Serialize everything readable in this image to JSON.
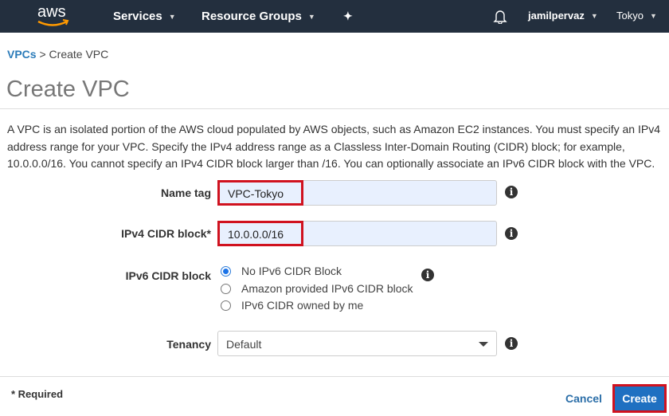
{
  "nav": {
    "logo": "aws",
    "services": "Services",
    "resource_groups": "Resource Groups",
    "user": "jamilpervaz",
    "region": "Tokyo"
  },
  "breadcrumb": {
    "parent": "VPCs",
    "separator": ">",
    "current": "Create VPC"
  },
  "page": {
    "title": "Create VPC",
    "description": "A VPC is an isolated portion of the AWS cloud populated by AWS objects, such as Amazon EC2 instances. You must specify an IPv4 address range for your VPC. Specify the IPv4 address range as a Classless Inter-Domain Routing (CIDR) block; for example, 10.0.0.0/16. You cannot specify an IPv4 CIDR block larger than /16. You can optionally associate an IPv6 CIDR block with the VPC."
  },
  "form": {
    "name_tag": {
      "label": "Name tag",
      "value": "VPC-Tokyo"
    },
    "ipv4": {
      "label": "IPv4 CIDR block*",
      "value": "10.0.0.0/16"
    },
    "ipv6": {
      "label": "IPv6 CIDR block",
      "options": [
        "No IPv6 CIDR Block",
        "Amazon provided IPv6 CIDR block",
        "IPv6 CIDR owned by me"
      ],
      "selected": "No IPv6 CIDR Block"
    },
    "tenancy": {
      "label": "Tenancy",
      "value": "Default"
    }
  },
  "footer": {
    "required": "* Required",
    "cancel": "Cancel",
    "create": "Create"
  },
  "colors": {
    "nav_bg": "#232f3e",
    "primary": "#1f70c1",
    "highlight": "#d0121f"
  }
}
